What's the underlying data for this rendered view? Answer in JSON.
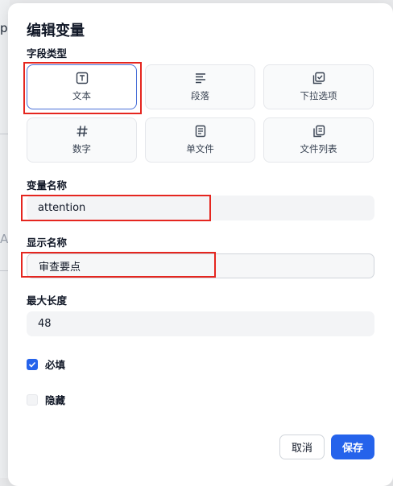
{
  "dialog": {
    "title": "编辑变量",
    "field_type_label": "字段类型",
    "field_types": [
      {
        "label": "文本",
        "icon": "text-type-icon",
        "selected": true
      },
      {
        "label": "段落",
        "icon": "paragraph-icon",
        "selected": false
      },
      {
        "label": "下拉选项",
        "icon": "dropdown-check-icon",
        "selected": false
      },
      {
        "label": "数字",
        "icon": "hash-icon",
        "selected": false
      },
      {
        "label": "单文件",
        "icon": "file-icon",
        "selected": false
      },
      {
        "label": "文件列表",
        "icon": "files-icon",
        "selected": false
      }
    ],
    "variable_name_label": "变量名称",
    "variable_name_value": "attention",
    "display_name_label": "显示名称",
    "display_name_value": "审查要点",
    "max_length_label": "最大长度",
    "max_length_value": "48",
    "required_label": "必填",
    "required_checked": true,
    "hidden_label": "隐藏",
    "hidden_checked": false,
    "cancel_label": "取消",
    "save_label": "保存"
  },
  "background": {
    "fragment_top": "p",
    "fragment_mid": "A"
  },
  "colors": {
    "accent": "#2563eb",
    "selected_border": "#4a70d8",
    "annotation": "#e5261f"
  }
}
